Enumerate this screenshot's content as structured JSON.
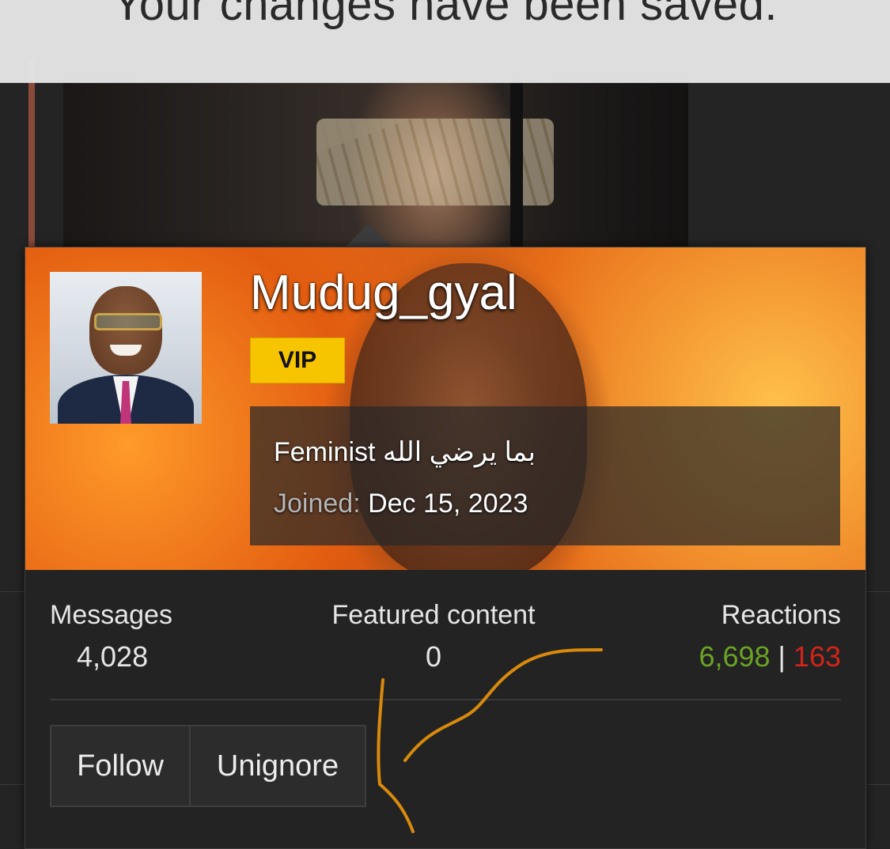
{
  "toast": {
    "message": "Your changes have been saved."
  },
  "profile": {
    "username": "Mudug_gyal",
    "badge": "VIP",
    "user_title": "Feminist بما يرضي الله",
    "joined_label": "Joined:",
    "joined_date": "Dec 15, 2023"
  },
  "stats": {
    "messages_label": "Messages",
    "messages_value": "4,028",
    "featured_label": "Featured content",
    "featured_value": "0",
    "reactions_label": "Reactions",
    "reactions_positive": "6,698",
    "reactions_separator": "|",
    "reactions_negative": "163"
  },
  "actions": {
    "follow_label": "Follow",
    "unignore_label": "Unignore"
  },
  "colors": {
    "vip_badge": "#f7c500",
    "reactions_positive": "#6aa324",
    "reactions_negative": "#d3241a",
    "annotation_stroke": "#d98a0c"
  }
}
